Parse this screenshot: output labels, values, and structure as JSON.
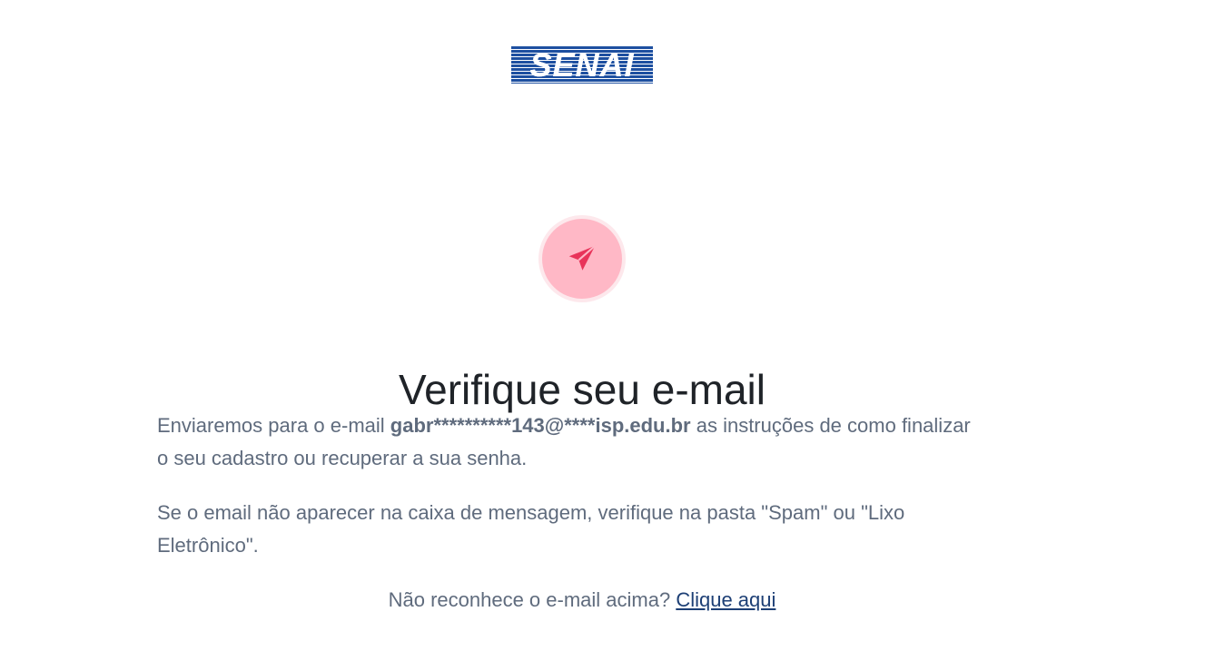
{
  "brand": {
    "logo_text": "SENAI",
    "logo_color": "#1d4fa0"
  },
  "hero_icon": {
    "name": "paper-plane-icon",
    "color": "#e8345a"
  },
  "title": "Verifique seu e-mail",
  "message": {
    "prefix": "Enviaremos para o e-mail ",
    "email": "gabr**********143@****isp.edu.br",
    "suffix": " as instruções de como finalizar o seu cadastro ou recuperar a sua senha."
  },
  "spam_notice": "Se o email não aparecer na caixa de mensagem, verifique na pasta \"Spam\" ou \"Lixo Eletrônico\".",
  "footer": {
    "question": "Não reconhece o e-mail acima? ",
    "link_label": "Clique aqui"
  }
}
